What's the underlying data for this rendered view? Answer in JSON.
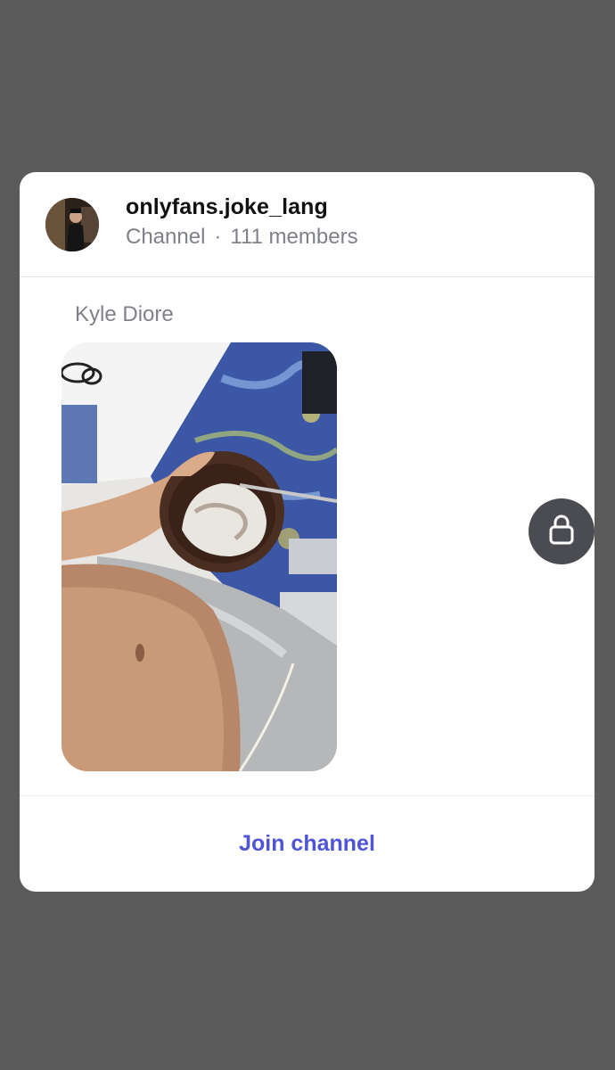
{
  "channel": {
    "name": "onlyfans.joke_lang",
    "type": "Channel",
    "separator": "·",
    "members": "111 members"
  },
  "message": {
    "sender": "Kyle Diore",
    "media_description": "photo"
  },
  "actions": {
    "join_label": "Join channel"
  },
  "icons": {
    "lock": "lock-icon",
    "avatar": "avatar"
  },
  "colors": {
    "backdrop": "#5b5b5b",
    "card": "#ffffff",
    "accent": "#4f55d6",
    "muted_text": "#7f8188",
    "lock_bg": "#4a4c51"
  }
}
